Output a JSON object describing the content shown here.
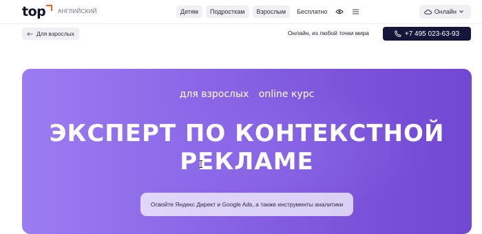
{
  "header": {
    "logo_text": "top",
    "logo_sub": "английский",
    "nav": [
      {
        "label": "Детям"
      },
      {
        "label": "Подросткам"
      },
      {
        "label": "Взрослым"
      }
    ],
    "free_label": "Бесплатно",
    "online_label": "Онлайн"
  },
  "subbar": {
    "back_label": "Для взрослых",
    "meta_text": "Онлайн, из любой точки мира",
    "phone": "+7 495 023-63-93"
  },
  "hero": {
    "tag_audience": "для взрослых",
    "tag_format": "online курс",
    "title_line1": "эксперт по контекстной",
    "title_line2": "рекламе",
    "subtitle": "Освойте Яндекс Директ и Google Ads, а также инструменты аналитики"
  },
  "colors": {
    "accent_orange": "#ff5a1f",
    "hero_purple": "#8a66e6",
    "phone_button": "#16163a"
  },
  "icons": [
    "logo-corner-icon",
    "eye-icon",
    "menu-icon",
    "cloud-icon",
    "chevron-down-icon",
    "arrow-left-icon",
    "phone-icon",
    "text-cursor-icon"
  ]
}
